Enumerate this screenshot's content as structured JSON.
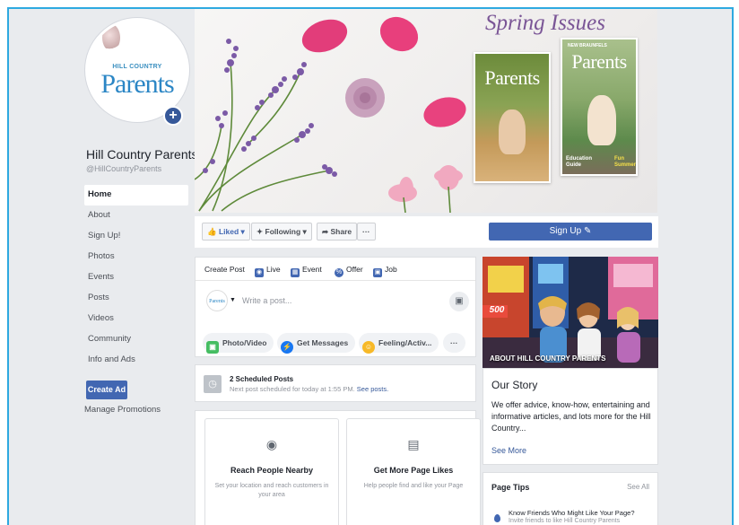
{
  "page": {
    "name": "Hill Country Parents",
    "handle": "@HillCountryParents",
    "logo_small": "HILL COUNTRY",
    "logo_big": "Parents",
    "add_photo_icon": "plus-icon"
  },
  "sidebar": {
    "items": [
      {
        "label": "Home"
      },
      {
        "label": "About"
      },
      {
        "label": "Sign Up!"
      },
      {
        "label": "Photos"
      },
      {
        "label": "Events"
      },
      {
        "label": "Posts"
      },
      {
        "label": "Videos"
      },
      {
        "label": "Community"
      },
      {
        "label": "Info and Ads"
      }
    ],
    "create_ad": "Create Ad",
    "manage_promotions": "Manage Promotions"
  },
  "cover": {
    "headline": "Spring Issues",
    "magazine1_title": "Parents",
    "magazine2_title": "Parents",
    "magazine2_masthead": "NEW BRAUNFELS",
    "magazine2_blurb1": "Education Guide",
    "magazine2_blurb2": "Fun Summer"
  },
  "actions": {
    "liked": "Liked",
    "following": "Following",
    "share": "Share",
    "more": "···",
    "sign_up": "Sign Up"
  },
  "composer": {
    "tabs": [
      {
        "label": "Create Post",
        "icon": "none"
      },
      {
        "label": "Live",
        "icon": "live-icon"
      },
      {
        "label": "Event",
        "icon": "calendar-icon"
      },
      {
        "label": "Offer",
        "icon": "offer-icon"
      },
      {
        "label": "Job",
        "icon": "briefcase-icon"
      }
    ],
    "placeholder": "Write a post...",
    "chips": [
      {
        "label": "Photo/Video",
        "icon": "photo-icon",
        "color": "#45bd62"
      },
      {
        "label": "Get Messages",
        "icon": "messenger-icon",
        "color": "#1877f2"
      },
      {
        "label": "Feeling/Activ...",
        "icon": "smiley-icon",
        "color": "#f7b928"
      }
    ],
    "chips_more": "···"
  },
  "scheduled": {
    "title": "2 Scheduled Posts",
    "desc": "Next post scheduled for today at 1:55 PM.",
    "link": "See posts."
  },
  "promo_cards": [
    {
      "title": "Reach People Nearby",
      "desc": "Set your location and reach customers in your area",
      "icon": "location-pin-icon"
    },
    {
      "title": "Get More Page Likes",
      "desc": "Help people find and like your Page",
      "icon": "page-icon"
    }
  ],
  "about": {
    "image_label": "ABOUT HILL COUNTRY PARENTS",
    "image_sign": "500",
    "story_heading": "Our Story",
    "story_body": "We offer advice, know-how, entertaining and informative articles, and lots more for the Hill Country...",
    "see_more": "See More"
  },
  "tips": {
    "heading": "Page Tips",
    "see_all": "See All",
    "tip_title": "Know Friends Who Might Like Your Page?",
    "tip_desc": "Invite friends to like Hill Country Parents"
  },
  "colors": {
    "frame_border": "#2ea9e0",
    "fb_blue": "#4267b2",
    "link_blue": "#365899",
    "background": "#e9ebee",
    "headline_purple": "#7a5596"
  }
}
